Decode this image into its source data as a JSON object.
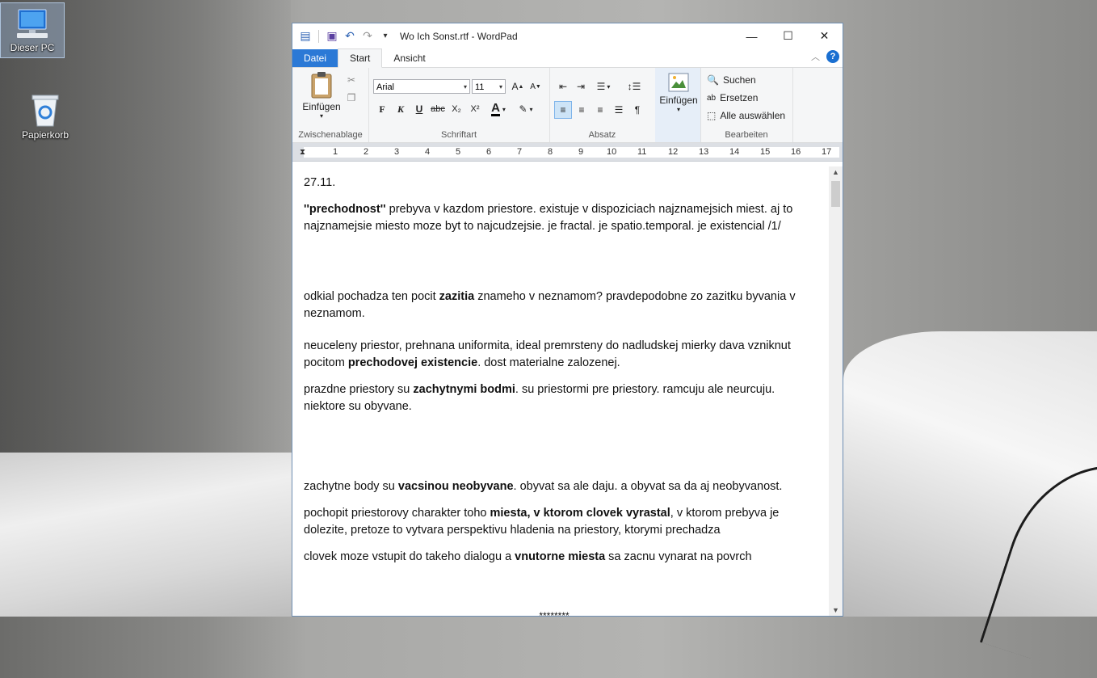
{
  "desktop": {
    "icons": [
      {
        "label": "Dieser PC"
      },
      {
        "label": "Papierkorb"
      }
    ]
  },
  "window": {
    "title": "Wo Ich Sonst.rtf - WordPad",
    "tabs": [
      "Datei",
      "Start",
      "Ansicht"
    ],
    "help_label": "?"
  },
  "ribbon": {
    "clipboard": {
      "paste_label": "Einfügen",
      "group_label": "Zwischenablage"
    },
    "font": {
      "family": "Arial",
      "size": "11",
      "group_label": "Schriftart",
      "bold": "F",
      "italic": "K",
      "underline": "U",
      "strike": "abc",
      "sub": "X₂",
      "sup": "X²",
      "color_letter": "A"
    },
    "paragraph": {
      "group_label": "Absatz"
    },
    "insert": {
      "label": "Einfügen"
    },
    "edit": {
      "find": "Suchen",
      "replace": "Ersetzen",
      "select_all": "Alle auswählen",
      "group_label": "Bearbeiten"
    }
  },
  "ruler": {
    "ticks": [
      "1",
      "2",
      "3",
      "4",
      "5",
      "6",
      "7",
      "8",
      "9",
      "10",
      "11",
      "12",
      "13",
      "14",
      "15",
      "16",
      "17"
    ]
  },
  "document": {
    "date": "27.11.",
    "p1_bold": "''prechodnost''",
    "p1_rest": " prebyva v kazdom priestore. existuje v dispoziciach najznamejsich miest. aj to najznamejsie miesto moze byt to najcudzejsie. je fractal. je spatio.temporal. je existencial /1/",
    "p2_a": "odkial pochadza ten pocit ",
    "p2_bold": "zazitia",
    "p2_b": " znameho v neznamom? pravdepodobne zo zazitku byvania v neznamom.",
    "p3_a": "neuceleny priestor, prehnana uniformita, ideal premrsteny do nadludskej mierky dava vzniknut pocitom ",
    "p3_bold": "prechodovej existencie",
    "p3_b": ". dost materialne zalozenej.",
    "p4_a": "prazdne priestory su ",
    "p4_bold": "zachytnymi bodmi",
    "p4_b": ". su priestormi pre priestory. ramcuju ale neurcuju. niektore su obyvane.",
    "p5_a": "zachytne body su ",
    "p5_bold": "vacsinou neobyvane",
    "p5_b": ". obyvat sa ale daju. a obyvat sa da aj neobyvanost.",
    "p6_a": "pochopit priestorovy charakter toho ",
    "p6_bold": "miesta, v ktorom clovek vyrastal",
    "p6_b": ", v ktorom prebyva je dolezite, pretoze to vytvara perspektivu hladenia na priestory, ktorymi prechadza",
    "p7_a": "clovek moze vstupit do takeho dialogu a ",
    "p7_bold": "vnutorne miesta",
    "p7_b": " sa zacnu vynarat na povrch",
    "separator": "********"
  }
}
